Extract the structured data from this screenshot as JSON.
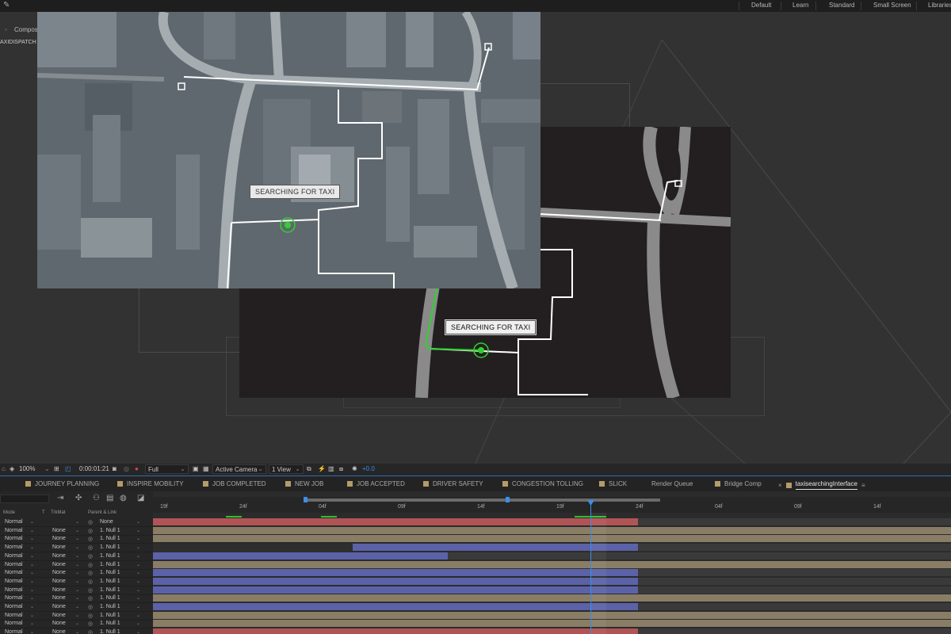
{
  "workspace": {
    "tabs": [
      "Default",
      "Learn",
      "Standard",
      "Small Screen",
      "Libraries"
    ]
  },
  "left_panel": {
    "tab_label": "Composit",
    "title": "AXIDISPATCH"
  },
  "viewer": {
    "front_label": "SEARCHING FOR TAXI",
    "back_label": "SEARCHING FOR TAXI",
    "colors": {
      "route_white": "#ffffff",
      "route_green": "#2fd12f",
      "dark_bg": "#231f20",
      "road_gray": "#8a8a8a"
    }
  },
  "viewer_controls": {
    "zoom": "100%",
    "timecode": "0:00:01:21",
    "resolution": "Full",
    "camera": "Active Camera",
    "views": "1 View",
    "exposure": "+0.0"
  },
  "comp_tabs": [
    "JOURNEY PLANNING",
    "INSPIRE MOBILITY",
    "JOB COMPLETED",
    "NEW JOB",
    "JOB ACCEPTED",
    "DRIVER SAFETY",
    "CONGESTION TOLLING",
    "SLICK",
    "Render Queue",
    "Bridge Comp",
    "taxisearchingInterface"
  ],
  "timeline": {
    "columns": {
      "mode": "Mode",
      "t": "T",
      "trkmat": "TrkMat",
      "parent": "Parent & Link"
    },
    "ruler_ticks": [
      "19f",
      "24f",
      "04f",
      "09f",
      "14f",
      "19f",
      "24f",
      "04f",
      "09f",
      "14f"
    ],
    "layers": [
      {
        "mode": "Normal",
        "trkmat": "",
        "parent": "None"
      },
      {
        "mode": "Normal",
        "trkmat": "None",
        "parent": "1. Null 1"
      },
      {
        "mode": "Normal",
        "trkmat": "None",
        "parent": "1. Null 1"
      },
      {
        "mode": "Normal",
        "trkmat": "None",
        "parent": "1. Null 1"
      },
      {
        "mode": "Normal",
        "trkmat": "None",
        "parent": "1. Null 1"
      },
      {
        "mode": "Normal",
        "trkmat": "None",
        "parent": "1. Null 1"
      },
      {
        "mode": "Normal",
        "trkmat": "None",
        "parent": "1. Null 1"
      },
      {
        "mode": "Normal",
        "trkmat": "None",
        "parent": "1. Null 1"
      },
      {
        "mode": "Normal",
        "trkmat": "None",
        "parent": "1. Null 1"
      },
      {
        "mode": "Normal",
        "trkmat": "None",
        "parent": "1. Null 1"
      },
      {
        "mode": "Normal",
        "trkmat": "None",
        "parent": "1. Null 1"
      },
      {
        "mode": "Normal",
        "trkmat": "None",
        "parent": "1. Null 1"
      },
      {
        "mode": "Normal",
        "trkmat": "None",
        "parent": "1. Null 1"
      },
      {
        "mode": "Normal",
        "trkmat": "None",
        "parent": "1. Null 1"
      }
    ],
    "layer_colors": {
      "red": "#b05456",
      "tan": "#8a7d66",
      "blue": "#5b62a8"
    }
  }
}
